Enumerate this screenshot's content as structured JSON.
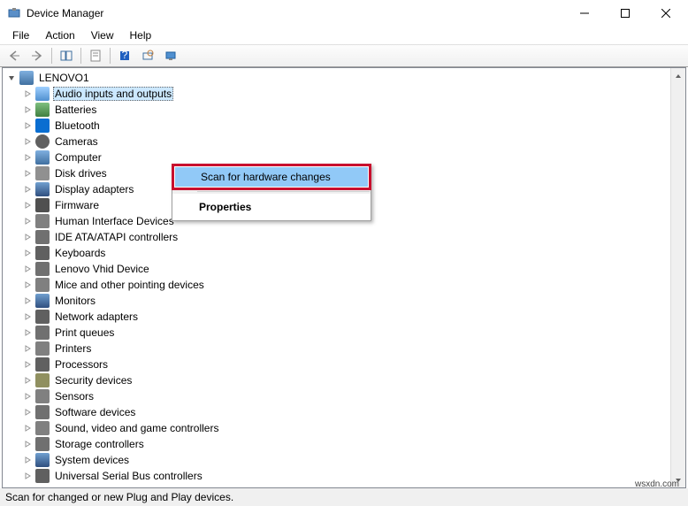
{
  "window": {
    "title": "Device Manager"
  },
  "menubar": {
    "items": [
      "File",
      "Action",
      "View",
      "Help"
    ]
  },
  "tree": {
    "root": "LENOVO1",
    "categories": [
      {
        "label": "Audio inputs and outputs",
        "icon": "audio",
        "selected": true
      },
      {
        "label": "Batteries",
        "icon": "battery"
      },
      {
        "label": "Bluetooth",
        "icon": "bluetooth"
      },
      {
        "label": "Cameras",
        "icon": "camera"
      },
      {
        "label": "Computer",
        "icon": "computer"
      },
      {
        "label": "Disk drives",
        "icon": "disk"
      },
      {
        "label": "Display adapters",
        "icon": "display"
      },
      {
        "label": "Firmware",
        "icon": "firmware"
      },
      {
        "label": "Human Interface Devices",
        "icon": "hid"
      },
      {
        "label": "IDE ATA/ATAPI controllers",
        "icon": "ide"
      },
      {
        "label": "Keyboards",
        "icon": "keyboard"
      },
      {
        "label": "Lenovo Vhid Device",
        "icon": "lenovo"
      },
      {
        "label": "Mice and other pointing devices",
        "icon": "mouse"
      },
      {
        "label": "Monitors",
        "icon": "monitor"
      },
      {
        "label": "Network adapters",
        "icon": "network"
      },
      {
        "label": "Print queues",
        "icon": "printq"
      },
      {
        "label": "Printers",
        "icon": "printer"
      },
      {
        "label": "Processors",
        "icon": "processor"
      },
      {
        "label": "Security devices",
        "icon": "security"
      },
      {
        "label": "Sensors",
        "icon": "sensor"
      },
      {
        "label": "Software devices",
        "icon": "software"
      },
      {
        "label": "Sound, video and game controllers",
        "icon": "sound"
      },
      {
        "label": "Storage controllers",
        "icon": "storage"
      },
      {
        "label": "System devices",
        "icon": "system"
      },
      {
        "label": "Universal Serial Bus controllers",
        "icon": "usb"
      }
    ]
  },
  "context_menu": {
    "items": [
      {
        "label": "Scan for hardware changes",
        "highlighted": true
      },
      {
        "label": "Properties",
        "bold": true
      }
    ]
  },
  "statusbar": {
    "text": "Scan for changed or new Plug and Play devices."
  },
  "watermark": "wsxdn.com"
}
